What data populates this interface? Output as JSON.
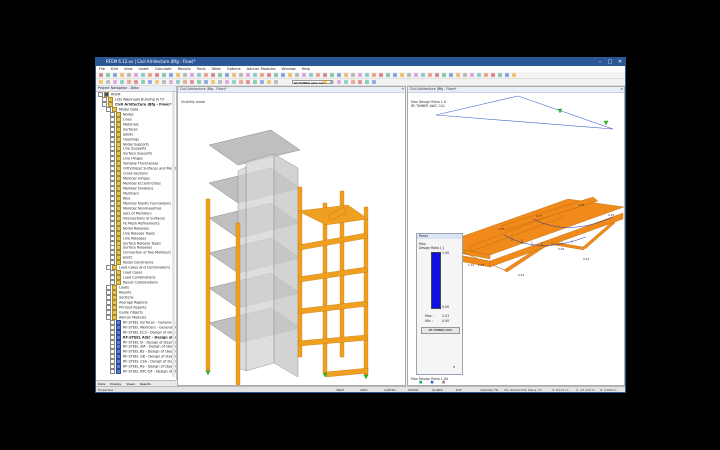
{
  "window": {
    "title": "RFEM 6.12.xx | Civil Arhitecture (Bfg - Flow)*",
    "controls": [
      "–",
      "□",
      "✕"
    ]
  },
  "menu": [
    "File",
    "Edit",
    "View",
    "Insert",
    "Calculate",
    "Results",
    "Tools",
    "Table",
    "Options",
    "Add-on Modules",
    "Window",
    "Help"
  ],
  "toolbar": {
    "combo_label": "RF-TIMBER AWC CO1",
    "colors": [
      "#c33",
      "#2a7",
      "#36c",
      "#e90",
      "#888",
      "#c6c",
      "#3aa",
      "#d63"
    ]
  },
  "navigator": {
    "header": "Project Navigator - Data",
    "items": [
      {
        "label": "RFEM",
        "indent": 0,
        "type": "root"
      },
      {
        "label": "Lets Waplnajet Building (k f)*",
        "indent": 1,
        "type": "folder"
      },
      {
        "label": "Civil Arhitecture (Bfg - Flow)*",
        "indent": 1,
        "type": "bold"
      },
      {
        "label": "Model Data",
        "indent": 2,
        "type": "folder"
      },
      {
        "label": "Nodes",
        "indent": 3,
        "type": "folder"
      },
      {
        "label": "Lines",
        "indent": 3,
        "type": "folder"
      },
      {
        "label": "Materials",
        "indent": 3,
        "type": "folder"
      },
      {
        "label": "Surfaces",
        "indent": 3,
        "type": "folder"
      },
      {
        "label": "Solids",
        "indent": 3,
        "type": "folder"
      },
      {
        "label": "Openings",
        "indent": 3,
        "type": "folder"
      },
      {
        "label": "Nodal Supports",
        "indent": 3,
        "type": "folder"
      },
      {
        "label": "Line Supports",
        "indent": 3,
        "type": "folder"
      },
      {
        "label": "Surface Supports",
        "indent": 3,
        "type": "folder"
      },
      {
        "label": "Line Hinges",
        "indent": 3,
        "type": "folder"
      },
      {
        "label": "Variable Thicknesses",
        "indent": 3,
        "type": "folder"
      },
      {
        "label": "Orthotropic Surfaces and Membranes",
        "indent": 3,
        "type": "folder"
      },
      {
        "label": "Cross-Sections",
        "indent": 3,
        "type": "folder"
      },
      {
        "label": "Member Hinges",
        "indent": 3,
        "type": "folder"
      },
      {
        "label": "Member Eccentricities",
        "indent": 3,
        "type": "folder"
      },
      {
        "label": "Member Divisions",
        "indent": 3,
        "type": "folder"
      },
      {
        "label": "Members",
        "indent": 3,
        "type": "folder"
      },
      {
        "label": "Ribs",
        "indent": 3,
        "type": "folder"
      },
      {
        "label": "Member Elastic Foundations",
        "indent": 3,
        "type": "folder"
      },
      {
        "label": "Member Nonlinearities",
        "indent": 3,
        "type": "folder"
      },
      {
        "label": "Sets of Members",
        "indent": 3,
        "type": "folder"
      },
      {
        "label": "Intersections of Surfaces",
        "indent": 3,
        "type": "folder"
      },
      {
        "label": "FE Mesh Refinements",
        "indent": 3,
        "type": "folder"
      },
      {
        "label": "Nodal Releases",
        "indent": 3,
        "type": "folder"
      },
      {
        "label": "Line Release Types",
        "indent": 3,
        "type": "folder"
      },
      {
        "label": "Line Releases",
        "indent": 3,
        "type": "folder"
      },
      {
        "label": "Surface Release Types",
        "indent": 3,
        "type": "folder"
      },
      {
        "label": "Surface Releases",
        "indent": 3,
        "type": "folder"
      },
      {
        "label": "Connection of Two Members",
        "indent": 3,
        "type": "folder"
      },
      {
        "label": "Joints",
        "indent": 3,
        "type": "folder"
      },
      {
        "label": "Nodal Constraints",
        "indent": 3,
        "type": "folder"
      },
      {
        "label": "Load Cases and Combinations",
        "indent": 2,
        "type": "folder"
      },
      {
        "label": "Load Cases",
        "indent": 3,
        "type": "folder"
      },
      {
        "label": "Load Combinations",
        "indent": 3,
        "type": "folder"
      },
      {
        "label": "Result Combinations",
        "indent": 3,
        "type": "folder"
      },
      {
        "label": "Loads",
        "indent": 2,
        "type": "folder"
      },
      {
        "label": "Results",
        "indent": 2,
        "type": "folder"
      },
      {
        "label": "Sections",
        "indent": 2,
        "type": "folder"
      },
      {
        "label": "Average Regions",
        "indent": 2,
        "type": "folder"
      },
      {
        "label": "Printout Reports",
        "indent": 2,
        "type": "folder"
      },
      {
        "label": "Guide Objects",
        "indent": 2,
        "type": "folder"
      },
      {
        "label": "Add-on Modules",
        "indent": 2,
        "type": "folder"
      },
      {
        "label": "RF-STEEL Surfaces - General stress",
        "indent": 3,
        "type": "module"
      },
      {
        "label": "RF-STEEL Members - General stress",
        "indent": 3,
        "type": "module"
      },
      {
        "label": "RF-STEEL EC3 - Design of steel mem",
        "indent": 3,
        "type": "module"
      },
      {
        "label": "RF-STEEL AISC - Design of steel",
        "indent": 3,
        "type": "modbold"
      },
      {
        "label": "RF-STEEL IS - Design of steel mem",
        "indent": 3,
        "type": "module"
      },
      {
        "label": "RF-STEEL SIA - Design of steel mem",
        "indent": 3,
        "type": "module"
      },
      {
        "label": "RF-STEEL BS - Design of steel mem",
        "indent": 3,
        "type": "module"
      },
      {
        "label": "RF-STEEL GB - Design of steel mem",
        "indent": 3,
        "type": "module"
      },
      {
        "label": "RF-STEEL CSA - Design of steel mem",
        "indent": 3,
        "type": "module"
      },
      {
        "label": "RF-STEEL AS - Design of steel mem",
        "indent": 3,
        "type": "module"
      },
      {
        "label": "RF-STEEL NTC-DF - Design of steel",
        "indent": 3,
        "type": "module"
      }
    ],
    "tabs": [
      "Data",
      "Display",
      "Views",
      "Results"
    ]
  },
  "viewport1": {
    "title": "Civil Arhitecture (Bfg - Flow)*",
    "mode_label": "Visibility mode"
  },
  "viewport2": {
    "title": "Civil Arhitecture (Bfg - Flow)*",
    "line1": "Max Design Ratio 1.0",
    "line2": "RF-TIMBER AWC CA1",
    "bottom": "Max Design Ratio 1.00",
    "values": [
      "0.71",
      "0.84",
      "0.52",
      "0.96",
      "0.44",
      "0.63",
      "0.77",
      "0.58",
      "0.29",
      "1.01"
    ]
  },
  "panel": {
    "title": "Panel",
    "sub1": "Max",
    "sub2": "Design Ratio [-]",
    "scale_top": "1.00",
    "scale_bot": "0.00",
    "max_label": "Max :",
    "max_val": "1.01",
    "min_label": "Min :",
    "min_val": "0.00",
    "button": "RF-TIMBER AWC"
  },
  "statusbar": {
    "left": "Properties",
    "items": [
      "SNAP",
      "GRID",
      "CARTES",
      "OSNAP",
      "GLINES",
      "DXF",
      "Visibility: FN",
      "CS: Global XYZ",
      "Plane: XY",
      "X: 8.171 m",
      "Y: -17.115 m",
      "Z: 0.000 m"
    ]
  }
}
